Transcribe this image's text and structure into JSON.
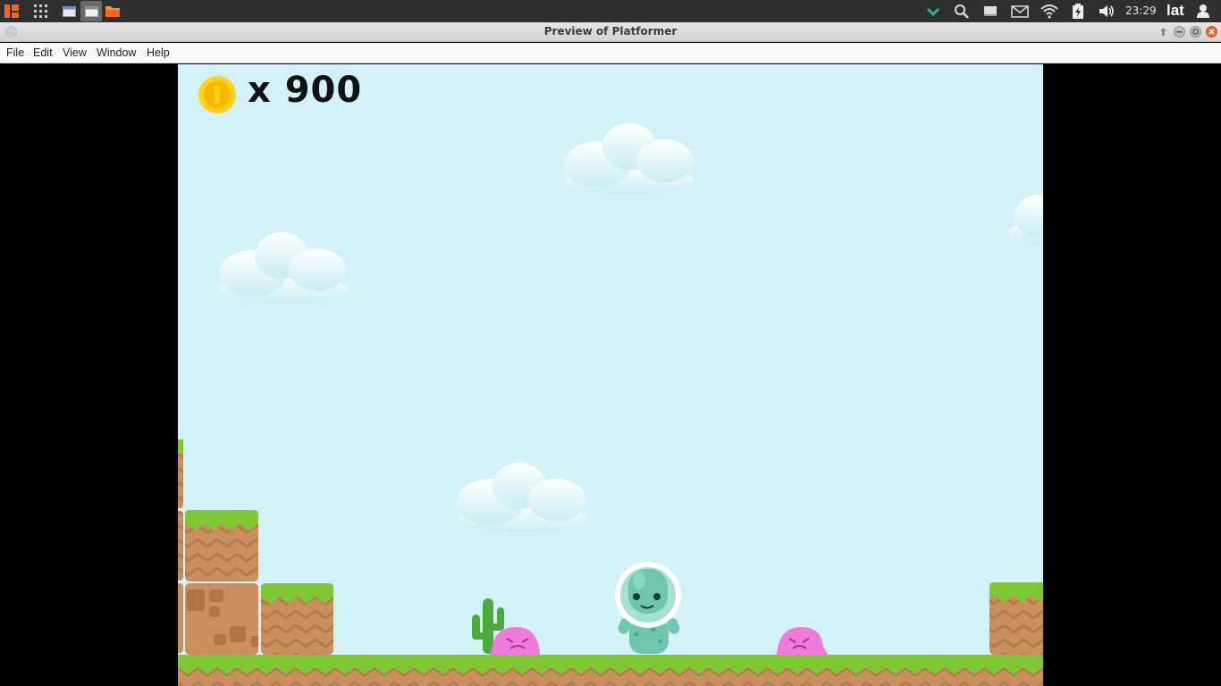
{
  "system_panel": {
    "clock": "23:29",
    "user": "lat",
    "icons": [
      "app-menu-icon",
      "apps-grid-icon",
      "window-icon",
      "window-icon",
      "folder-icon",
      "check-icon",
      "search-icon",
      "display-icon",
      "mail-icon",
      "wifi-icon",
      "battery-icon",
      "volume-icon",
      "user-icon"
    ]
  },
  "window": {
    "title": "Preview of Platformer"
  },
  "menubar": {
    "items": [
      "File",
      "Edit",
      "View",
      "Window",
      "Help"
    ]
  },
  "game": {
    "coin_count": "x 900",
    "colors": {
      "sky": "#d2f2f7",
      "grass": "#7ec834",
      "dirt": "#c98f5f",
      "player": "#6fc6ae",
      "enemy": "#ee7ad9",
      "coin": "#ffd21a"
    }
  }
}
